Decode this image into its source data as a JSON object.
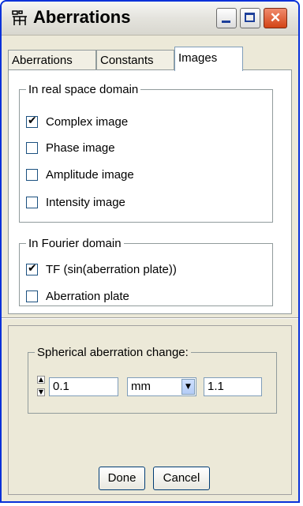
{
  "window": {
    "title": "Aberrations",
    "close_glyph": "✕"
  },
  "tabs": [
    {
      "label": "Aberrations"
    },
    {
      "label": "Constants"
    },
    {
      "label": "Images"
    }
  ],
  "real_space": {
    "legend": "In real space domain",
    "items": [
      {
        "label": "Complex image",
        "checked": true
      },
      {
        "label": "Phase image",
        "checked": false
      },
      {
        "label": "Amplitude image",
        "checked": false
      },
      {
        "label": "Intensity image",
        "checked": false
      }
    ]
  },
  "fourier": {
    "legend": "In Fourier domain",
    "items": [
      {
        "label": "TF (sin(aberration plate))",
        "checked": true
      },
      {
        "label": "Aberration plate",
        "checked": false
      }
    ]
  },
  "spherical": {
    "legend": "Spherical aberration change:",
    "step_value": "0.1",
    "unit": "mm",
    "value": "1.1"
  },
  "buttons": {
    "done": "Done",
    "cancel": "Cancel"
  }
}
